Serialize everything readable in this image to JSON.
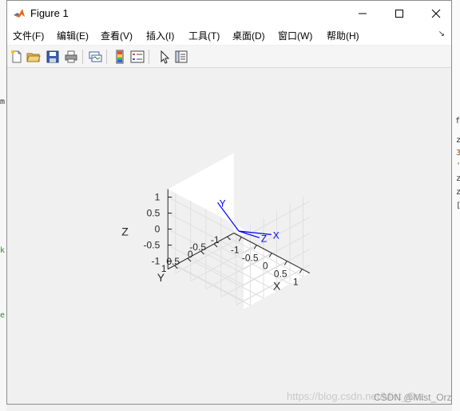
{
  "window": {
    "title": "Figure 1",
    "controls": {
      "minimize": "–",
      "maximize": "☐",
      "close": "✕"
    }
  },
  "menu": [
    "文件(F)",
    "编辑(E)",
    "查看(V)",
    "插入(I)",
    "工具(T)",
    "桌面(D)",
    "窗口(W)",
    "帮助(H)"
  ],
  "toolbar_icons": [
    "new-figure-icon",
    "open-file-icon",
    "save-icon",
    "print-icon",
    "link-plot-icon",
    "insert-colorbar-icon",
    "insert-legend-icon",
    "pointer-icon",
    "property-editor-icon"
  ],
  "chart_data": {
    "type": "line3d",
    "axis_names": {
      "x": "X",
      "y": "Y",
      "z": "Z"
    },
    "x_ticks": [
      "-1",
      "-0.5",
      "0",
      "0.5",
      "1"
    ],
    "y_ticks": [
      "-1",
      "-0.5",
      "0",
      "0.5",
      "1"
    ],
    "z_ticks": [
      "-1",
      "-0.5",
      "0",
      "0.5",
      "1"
    ],
    "xlim": [
      -1.25,
      1.25
    ],
    "ylim": [
      -1.25,
      1.25
    ],
    "zlim": [
      -1.25,
      1.25
    ],
    "grid": true,
    "vectors": [
      {
        "label": "Y",
        "from": [
          0,
          0,
          0
        ],
        "to": [
          0,
          0.8,
          1.25
        ]
      },
      {
        "label": "X",
        "from": [
          0,
          0,
          0
        ],
        "to": [
          0.9,
          -0.2,
          0.25
        ]
      },
      {
        "label": "Z",
        "from": [
          0,
          0,
          0
        ],
        "to": [
          0.55,
          -0.15,
          0
        ]
      }
    ],
    "line_color": "#0000ff",
    "grid_color": "#e0e0e0",
    "axis_color": "#262626"
  },
  "watermark": "https://blog.csdn.net/Mist_Orz",
  "credit": "CSDN @Mist_Orz",
  "background": {
    "left_fragments": [
      "m",
      "k",
      "e"
    ],
    "right_fragments": [
      "f",
      "z",
      "3",
      "'",
      "z",
      "z",
      "["
    ]
  }
}
